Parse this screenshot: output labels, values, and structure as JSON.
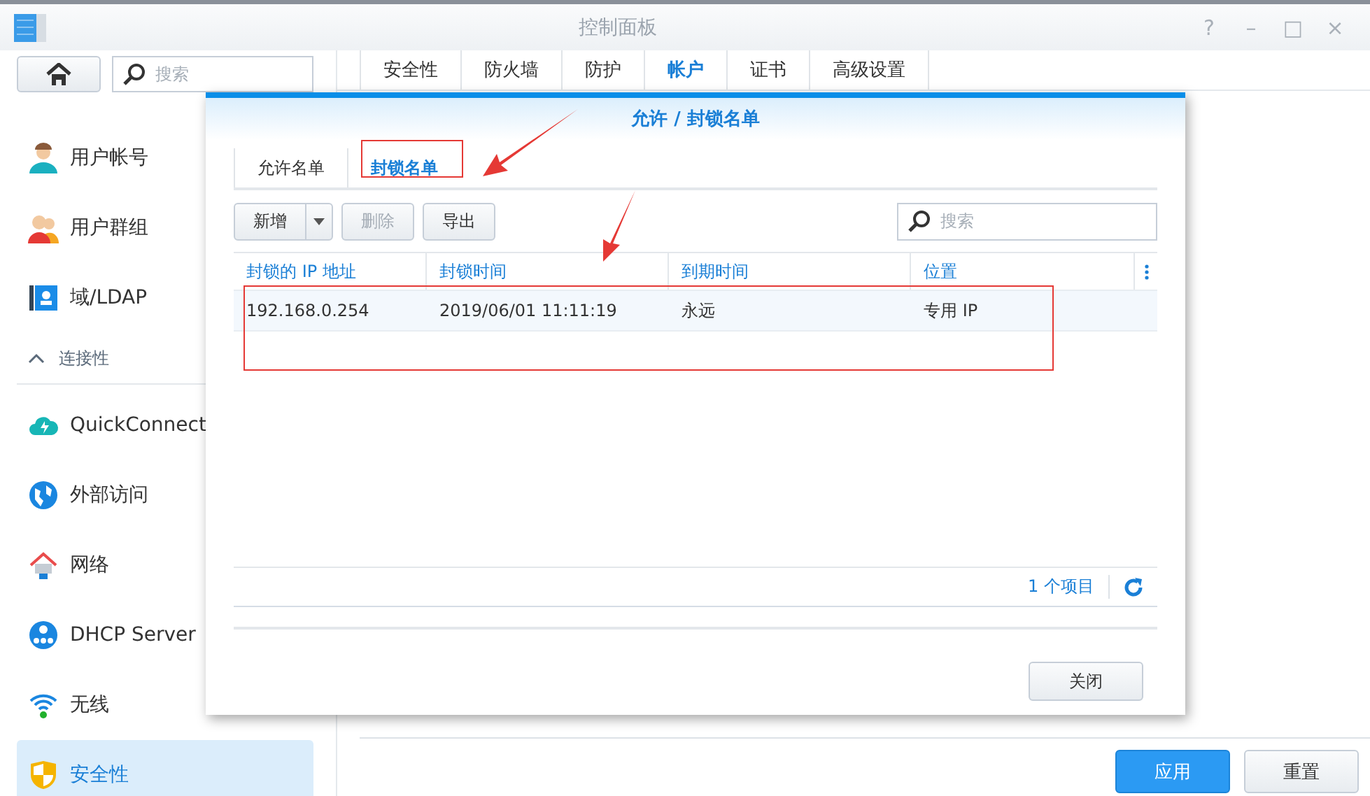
{
  "window": {
    "title": "控制面板",
    "controls": [
      "?",
      "–",
      "□",
      "×"
    ]
  },
  "sidebar": {
    "search": {
      "placeholder": "搜索"
    },
    "items": [
      {
        "kind": "item",
        "label": "用户帐号",
        "selected": false
      },
      {
        "kind": "item",
        "label": "用户群组",
        "selected": false
      },
      {
        "kind": "item",
        "label": "域/LDAP",
        "selected": false
      },
      {
        "kind": "section",
        "label": "连接性",
        "expanded": true
      },
      {
        "kind": "item",
        "label": "QuickConnect",
        "selected": false
      },
      {
        "kind": "item",
        "label": "外部访问",
        "selected": false
      },
      {
        "kind": "item",
        "label": "网络",
        "selected": false
      },
      {
        "kind": "item",
        "label": "DHCP Server",
        "selected": false
      },
      {
        "kind": "item",
        "label": "无线",
        "selected": false
      },
      {
        "kind": "item",
        "label": "安全性",
        "selected": true
      }
    ]
  },
  "tabs": [
    {
      "label": "安全性",
      "selected": false
    },
    {
      "label": "防火墙",
      "selected": false
    },
    {
      "label": "防护",
      "selected": false
    },
    {
      "label": "帐户",
      "selected": true
    },
    {
      "label": "证书",
      "selected": false
    },
    {
      "label": "高级设置",
      "selected": false
    }
  ],
  "footer_buttons": [
    {
      "label": "应用",
      "kind": "primary"
    },
    {
      "label": "重置",
      "kind": "default"
    }
  ],
  "dialog": {
    "title": "允许 / 封锁名单",
    "tabs": [
      {
        "label": "允许名单",
        "selected": false
      },
      {
        "label": "封锁名单",
        "selected": true
      }
    ],
    "toolbar": [
      {
        "label": "新增",
        "disabled": false,
        "dropdown": true
      },
      {
        "label": "删除",
        "disabled": true,
        "dropdown": false
      },
      {
        "label": "导出",
        "disabled": false,
        "dropdown": false
      }
    ],
    "search": {
      "placeholder": "搜索"
    },
    "table": {
      "columns": [
        "封锁的 IP 地址",
        "封锁时间",
        "到期时间",
        "位置"
      ],
      "rows": [
        [
          "192.168.0.254",
          "2019/06/01 11:11:19",
          "永远",
          "专用 IP"
        ]
      ]
    },
    "count": "1 个项目",
    "close": "关闭"
  }
}
